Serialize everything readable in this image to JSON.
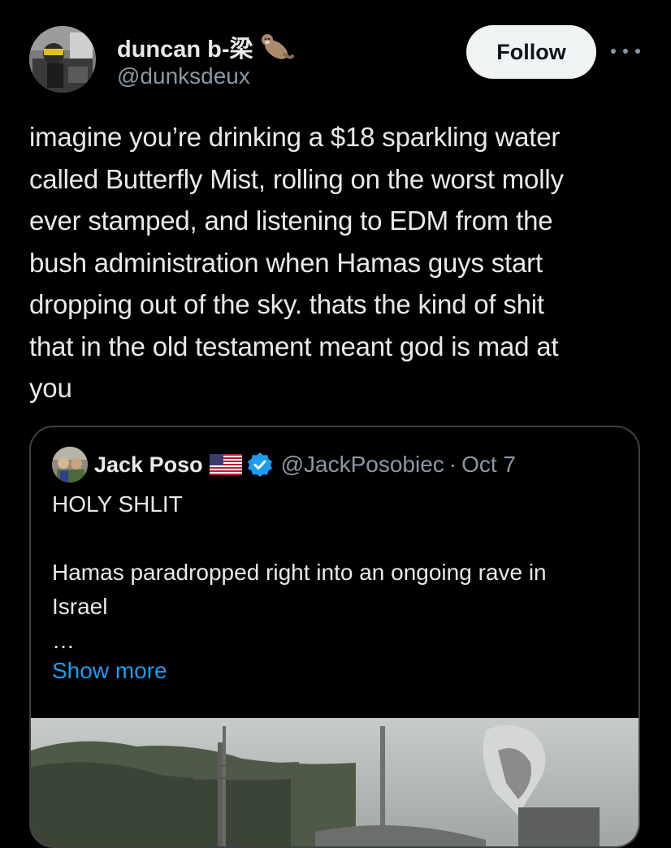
{
  "author": {
    "name": "duncan b-梁",
    "handle": "@dunksdeux",
    "follow_label": "Follow"
  },
  "tweet": {
    "text": "imagine you’re drinking a $18 sparkling water\ncalled Butterfly Mist, rolling on the worst molly\never stamped, and listening to EDM from the\nbush administration when Hamas guys start\ndropping out of the sky. thats the kind of shit\nthat in the old testament meant god is mad at\nyou"
  },
  "quote": {
    "name": "Jack Poso",
    "handle": "@JackPosobiec",
    "separator": "·",
    "date": "Oct 7",
    "text": "HOLY SHLIT\n\nHamas paradropped right into an ongoing rave in\nIsrael\n…",
    "show_more": "Show more"
  },
  "colors": {
    "background": "#000000",
    "text": "#e7e9ea",
    "muted": "#8b98a5",
    "link": "#1d9bf0",
    "follow_bg": "#eff3f4"
  }
}
